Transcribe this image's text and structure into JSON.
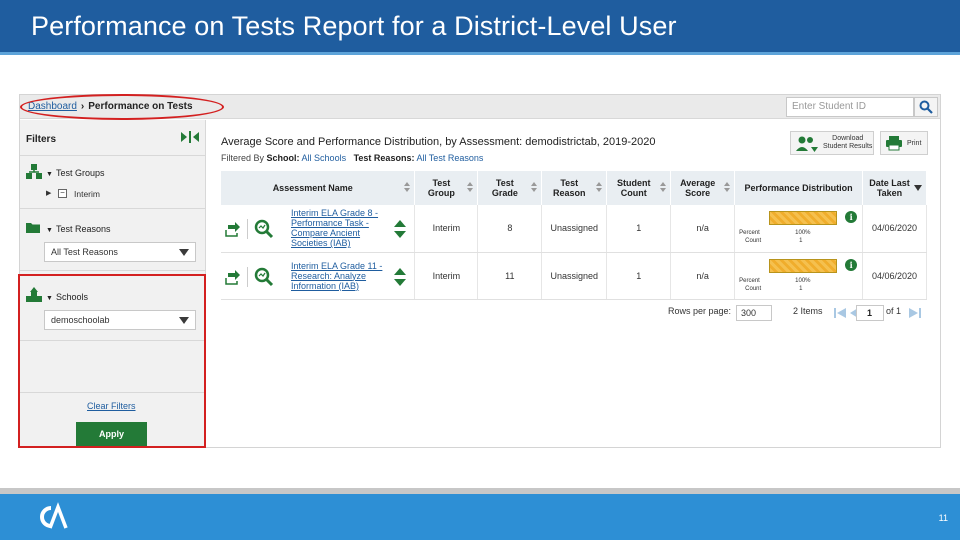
{
  "slide": {
    "title": "Performance on Tests Report for a District-Level User",
    "page_number": "11"
  },
  "breadcrumb": {
    "link": "Dashboard",
    "separator": "›",
    "current": "Performance on Tests"
  },
  "search": {
    "placeholder": "Enter Student ID"
  },
  "sidebar": {
    "title": "Filters",
    "test_groups": {
      "label": "Test Groups",
      "item": "Interim"
    },
    "test_reasons": {
      "label": "Test Reasons",
      "selected": "All Test Reasons"
    },
    "schools": {
      "label": "Schools",
      "selected": "demoschoolab"
    },
    "clear_filters": "Clear Filters",
    "apply": "Apply"
  },
  "main": {
    "title": "Average Score and Performance Distribution, by Assessment: demodistrictab, 2019-2020",
    "filtered_by": "Filtered By",
    "school_key": "School:",
    "school_value": "All Schools",
    "reasons_key": "Test Reasons:",
    "reasons_value": "All Test Reasons",
    "download_label_1": "Download",
    "download_label_2": "Student Results",
    "print_label": "Print"
  },
  "table": {
    "headers": {
      "assessment": "Assessment Name",
      "group_1": "Test",
      "group_2": "Group",
      "grade_1": "Test",
      "grade_2": "Grade",
      "reason_1": "Test",
      "reason_2": "Reason",
      "count_1": "Student",
      "count_2": "Count",
      "avg_1": "Average",
      "avg_2": "Score",
      "perf": "Performance Distribution",
      "date_1": "Date Last",
      "date_2": "Taken"
    },
    "rows": [
      {
        "name": "Interim ELA Grade 8 - Performance Task - Compare Ancient Societies (IAB)",
        "group": "Interim",
        "grade": "8",
        "reason": "Unassigned",
        "count": "1",
        "avg": "n/a",
        "perf_percent_label": "Percent",
        "perf_count_label": "Count",
        "perf_percent": "100%",
        "perf_count": "1",
        "date": "04/06/2020"
      },
      {
        "name": "Interim ELA Grade 11 - Research: Analyze Information (IAB)",
        "group": "Interim",
        "grade": "11",
        "reason": "Unassigned",
        "count": "1",
        "avg": "n/a",
        "perf_percent_label": "Percent",
        "perf_count_label": "Count",
        "perf_percent": "100%",
        "perf_count": "1",
        "date": "04/06/2020"
      }
    ]
  },
  "pager": {
    "rows_per_page_label": "Rows per page:",
    "rows_per_page": "300",
    "items": "2 Items",
    "page": "1",
    "of": "of 1"
  },
  "colors": {
    "title_bar": "#1f5d9f",
    "footer": "#2d8fd5",
    "apply_button": "#237a37",
    "highlight": "#d32020",
    "perf_bar": "#f5c04e"
  }
}
